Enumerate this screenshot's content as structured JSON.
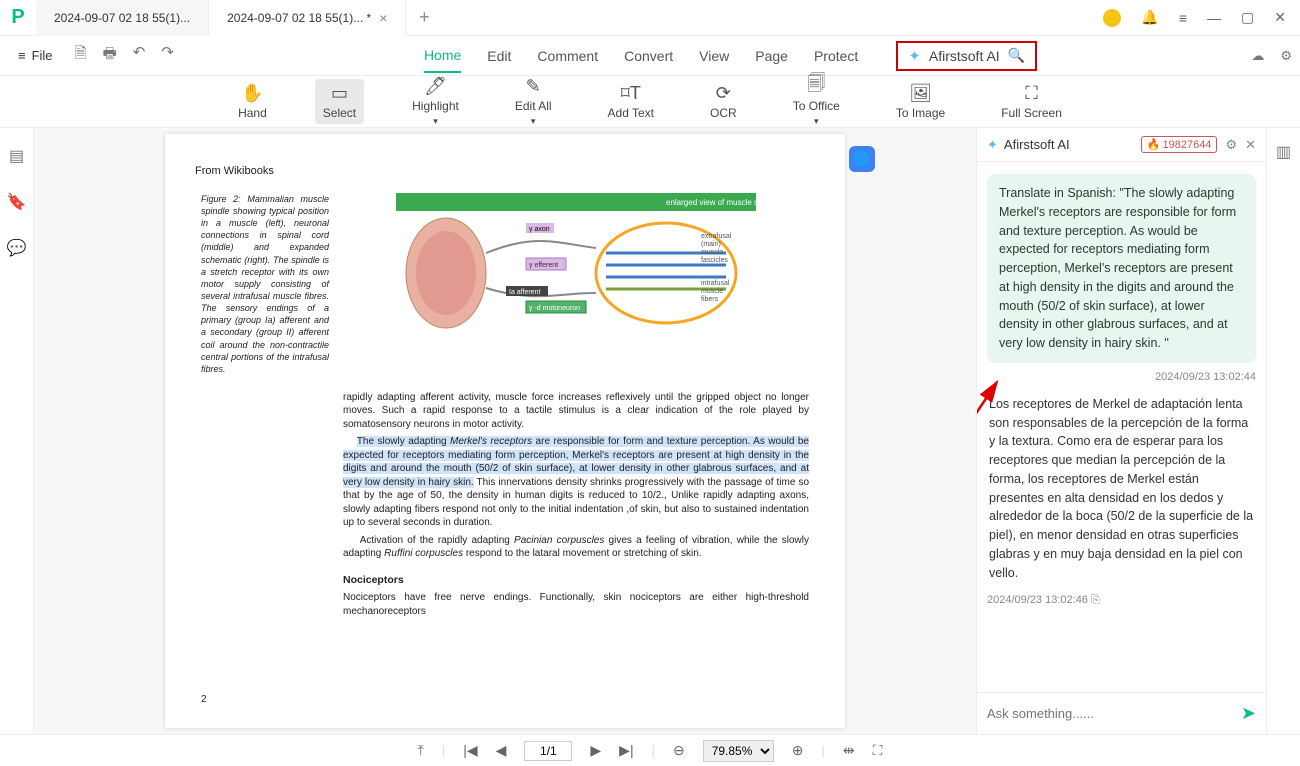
{
  "tabs": {
    "inactive": "2024-09-07 02 18 55(1)...",
    "active": "2024-09-07 02 18 55(1)... *"
  },
  "menu": {
    "file": "File"
  },
  "topTabs": {
    "home": "Home",
    "edit": "Edit",
    "comment": "Comment",
    "convert": "Convert",
    "view": "View",
    "page": "Page",
    "protect": "Protect"
  },
  "ai": {
    "brand": "Afirstsoft AI",
    "tokens": "19827644",
    "userMsg": "Translate in Spanish: \"The slowly adapting Merkel's receptors are responsible for form and texture perception. As would be expected for receptors mediating form perception, Merkel's receptors are present at high density in the digits and around the mouth (50/2 of skin surface), at lower density in other glabrous surfaces, and at very low density in hairy skin. \"",
    "ts1": "2024/09/23 13:02:44",
    "botMsg": "Los receptores de Merkel de adaptación lenta son responsables de la percepción de la forma y la textura. Como era de esperar para los receptores que median la percepción de la forma, los receptores de Merkel están presentes en alta densidad en los dedos y alrededor de la boca (50/2 de la superficie de la piel), en menor densidad en otras superficies glabras y en muy baja densidad en la piel con vello.",
    "ts2": "2024/09/23 13:02:46",
    "placeholder": "Ask something......"
  },
  "tools": {
    "hand": "Hand",
    "select": "Select",
    "highlight": "Highlight",
    "editall": "Edit All",
    "addtext": "Add Text",
    "ocr": "OCR",
    "tooffice": "To Office",
    "toimage": "To Image",
    "fullscreen": "Full Screen"
  },
  "doc": {
    "source": "From Wikibooks",
    "figCaption": "Figure 2: Mammalian muscle spindle showing typical position in a muscle (left), neuronal connections in spinal cord (middle) and expanded schematic (right). The spindle is a stretch receptor with its own motor supply consisting of several intrafusal muscle fibres. The sensory endings of a primary (group Ia) afferent and a secondary (group II) afferent coil around the non-contractile central portions of the intrafusal fibres.",
    "para1": "rapidly adapting afferent activity, muscle force increases reflexively until the gripped object no longer moves. Such a rapid response to a tactile stimulus is a clear indication of the role played by somatosensory neurons in motor activity.",
    "hl1": "The slowly adapting ",
    "hl_em": "Merkel's receptors",
    "hl2": " are responsible for form and texture perception. As would be expected for receptors mediating form perception, Merkel's receptors are present at high density in the digits and around the mouth (50/2 of skin surface), at lower density in other glabrous surfaces, and at very low density in hairy skin.",
    "para2": " This innervations density shrinks progressively with the passage of time so that by the age of 50, the density in human digits is reduced to 10/2., Unlike rapidly adapting axons, slowly adapting fibers respond not only to the initial indentation ,of skin, but also to sustained indentation up to several seconds in duration.",
    "para3a": "Activation of the rapidly adapting ",
    "pac": "Pacinian corpuscles",
    "para3b": " gives a feeling of vibration, while the slowly adapting ",
    "ruf": "Ruffini corpuscles",
    "para3c": " respond to the lataral movement or stretching of skin.",
    "nocihead": "Nociceptors",
    "noci": "Nociceptors have free nerve endings. Functionally, skin nociceptors are either high-threshold mechanoreceptors",
    "pageNum": "2"
  },
  "status": {
    "page": "1/1",
    "totalPages": "1",
    "zoom": "79.85%"
  }
}
